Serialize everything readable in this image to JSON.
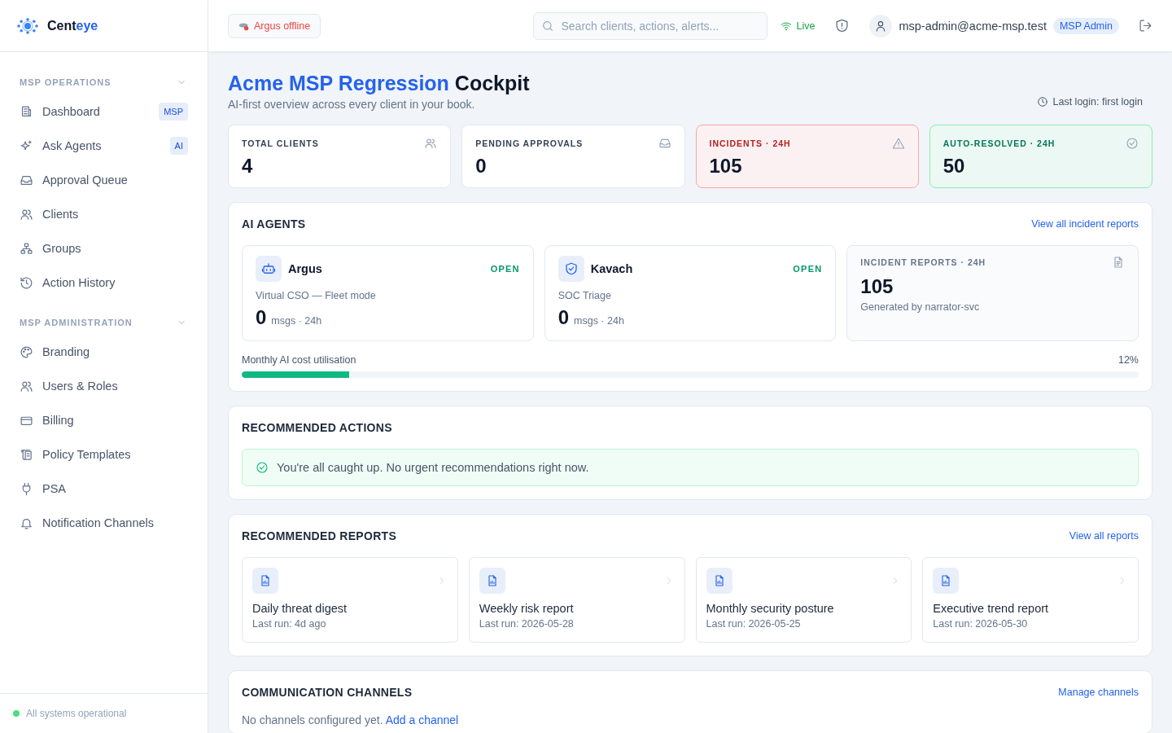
{
  "brand": {
    "name": "Cent",
    "accent": "eye"
  },
  "sidebar": {
    "sections": [
      {
        "title": "MSP OPERATIONS",
        "expanded": true,
        "items": [
          {
            "label": "Dashboard",
            "badge": "MSP"
          },
          {
            "label": "Ask Agents",
            "badge": "AI"
          },
          {
            "label": "Approval Queue"
          },
          {
            "label": "Clients"
          },
          {
            "label": "Groups"
          },
          {
            "label": "Action History"
          }
        ]
      },
      {
        "title": "MSP ADMINISTRATION",
        "expanded": true,
        "items": [
          {
            "label": "Branding"
          },
          {
            "label": "Users & Roles"
          },
          {
            "label": "Billing"
          },
          {
            "label": "Policy Templates"
          },
          {
            "label": "PSA"
          },
          {
            "label": "Notification Channels"
          }
        ]
      }
    ],
    "footer": {
      "text": "All systems operational",
      "color": "#4ade80"
    }
  },
  "header": {
    "agent_status": {
      "label": "Argus offline",
      "online": false
    },
    "search": {
      "placeholder": "Search clients, actions, alerts..."
    },
    "connection": {
      "label": "Live",
      "live": true
    },
    "user": {
      "email": "msp-admin@acme-msp.test",
      "role": "MSP Admin"
    }
  },
  "page": {
    "title": "Acme MSP Regression",
    "title_suffix": "Cockpit",
    "subtitle": "AI-first overview across every client in your book.",
    "last_login": "Last login: first login"
  },
  "stats": [
    {
      "label": "TOTAL CLIENTS",
      "value": "4",
      "kind": "neutral"
    },
    {
      "label": "PENDING APPROVALS",
      "value": "0",
      "kind": "neutral"
    },
    {
      "label": "INCIDENTS · 24H",
      "value": "105",
      "kind": "danger"
    },
    {
      "label": "AUTO-RESOLVED · 24H",
      "value": "50",
      "kind": "success"
    }
  ],
  "ai_agents": {
    "title": "AI AGENTS",
    "link": "View all incident reports",
    "agents": [
      {
        "name": "Argus",
        "status": "OPEN",
        "description": "Virtual CSO — Fleet mode",
        "count": "0",
        "unit": "msgs · 24h"
      },
      {
        "name": "Kavach",
        "status": "OPEN",
        "description": "SOC Triage",
        "count": "0",
        "unit": "msgs · 24h"
      }
    ],
    "reports_card": {
      "label": "INCIDENT REPORTS · 24H",
      "value": "105",
      "note": "Generated by narrator-svc"
    },
    "cost": {
      "label": "Monthly AI cost utilisation",
      "reading": "12%",
      "level": 0.12
    }
  },
  "recommended_actions": {
    "title": "RECOMMENDED ACTIONS",
    "message": "You're all caught up. No urgent recommendations right now."
  },
  "recommended_reports": {
    "title": "RECOMMENDED REPORTS",
    "link": "View all reports",
    "reports": [
      {
        "name": "Daily threat digest",
        "last_run": "Last run: 4d ago"
      },
      {
        "name": "Weekly risk report",
        "last_run": "Last run: 2026-05-28"
      },
      {
        "name": "Monthly security posture",
        "last_run": "Last run: 2026-05-25"
      },
      {
        "name": "Executive trend report",
        "last_run": "Last run: 2026-05-30"
      }
    ]
  },
  "communication_channels": {
    "title": "COMMUNICATION CHANNELS",
    "link": "Manage channels",
    "empty_text": "No channels configured yet.",
    "empty_link": "Add a channel"
  }
}
